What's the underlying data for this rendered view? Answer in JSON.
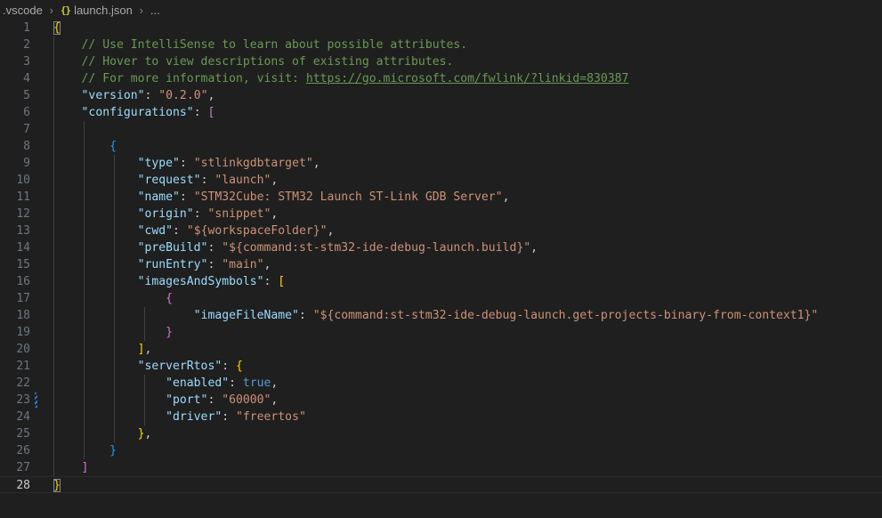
{
  "breadcrumb": {
    "folder": ".vscode",
    "file_icon": "{}",
    "file": "launch.json",
    "more": "..."
  },
  "editor": {
    "current_line": 28,
    "lines": [
      {
        "n": "1",
        "tokens": [
          {
            "t": "{",
            "c": "b1 bm"
          }
        ]
      },
      {
        "n": "2",
        "tokens": [
          {
            "t": "    "
          },
          {
            "t": "// Use IntelliSense to learn about possible attributes.",
            "c": "c"
          }
        ]
      },
      {
        "n": "3",
        "tokens": [
          {
            "t": "    "
          },
          {
            "t": "// Hover to view descriptions of existing attributes.",
            "c": "c"
          }
        ]
      },
      {
        "n": "4",
        "tokens": [
          {
            "t": "    "
          },
          {
            "t": "// For more information, visit: ",
            "c": "c"
          },
          {
            "t": "https://go.microsoft.com/fwlink/?linkid=830387",
            "c": "u",
            "link": true
          }
        ]
      },
      {
        "n": "5",
        "tokens": [
          {
            "t": "    "
          },
          {
            "t": "\"version\"",
            "c": "k"
          },
          {
            "t": ": ",
            "c": "p"
          },
          {
            "t": "\"0.2.0\"",
            "c": "s"
          },
          {
            "t": ",",
            "c": "p"
          }
        ]
      },
      {
        "n": "6",
        "tokens": [
          {
            "t": "    "
          },
          {
            "t": "\"configurations\"",
            "c": "k"
          },
          {
            "t": ": ",
            "c": "p"
          },
          {
            "t": "[",
            "c": "b2"
          }
        ]
      },
      {
        "n": "7",
        "tokens": [
          {
            "t": ""
          }
        ]
      },
      {
        "n": "8",
        "tokens": [
          {
            "t": "        "
          },
          {
            "t": "{",
            "c": "b3"
          }
        ]
      },
      {
        "n": "9",
        "tokens": [
          {
            "t": "            "
          },
          {
            "t": "\"type\"",
            "c": "k"
          },
          {
            "t": ": ",
            "c": "p"
          },
          {
            "t": "\"stlinkgdbtarget\"",
            "c": "s"
          },
          {
            "t": ",",
            "c": "p"
          }
        ]
      },
      {
        "n": "10",
        "tokens": [
          {
            "t": "            "
          },
          {
            "t": "\"request\"",
            "c": "k"
          },
          {
            "t": ": ",
            "c": "p"
          },
          {
            "t": "\"launch\"",
            "c": "s"
          },
          {
            "t": ",",
            "c": "p"
          }
        ]
      },
      {
        "n": "11",
        "tokens": [
          {
            "t": "            "
          },
          {
            "t": "\"name\"",
            "c": "k"
          },
          {
            "t": ": ",
            "c": "p"
          },
          {
            "t": "\"STM32Cube: STM32 Launch ST-Link GDB Server\"",
            "c": "s"
          },
          {
            "t": ",",
            "c": "p"
          }
        ]
      },
      {
        "n": "12",
        "tokens": [
          {
            "t": "            "
          },
          {
            "t": "\"origin\"",
            "c": "k"
          },
          {
            "t": ": ",
            "c": "p"
          },
          {
            "t": "\"snippet\"",
            "c": "s"
          },
          {
            "t": ",",
            "c": "p"
          }
        ]
      },
      {
        "n": "13",
        "tokens": [
          {
            "t": "            "
          },
          {
            "t": "\"cwd\"",
            "c": "k"
          },
          {
            "t": ": ",
            "c": "p"
          },
          {
            "t": "\"${workspaceFolder}\"",
            "c": "s"
          },
          {
            "t": ",",
            "c": "p"
          }
        ]
      },
      {
        "n": "14",
        "tokens": [
          {
            "t": "            "
          },
          {
            "t": "\"preBuild\"",
            "c": "k"
          },
          {
            "t": ": ",
            "c": "p"
          },
          {
            "t": "\"${command:st-stm32-ide-debug-launch.build}\"",
            "c": "s"
          },
          {
            "t": ",",
            "c": "p"
          }
        ]
      },
      {
        "n": "15",
        "tokens": [
          {
            "t": "            "
          },
          {
            "t": "\"runEntry\"",
            "c": "k"
          },
          {
            "t": ": ",
            "c": "p"
          },
          {
            "t": "\"main\"",
            "c": "s"
          },
          {
            "t": ",",
            "c": "p"
          }
        ]
      },
      {
        "n": "16",
        "tokens": [
          {
            "t": "            "
          },
          {
            "t": "\"imagesAndSymbols\"",
            "c": "k"
          },
          {
            "t": ": ",
            "c": "p"
          },
          {
            "t": "[",
            "c": "b1"
          }
        ]
      },
      {
        "n": "17",
        "tokens": [
          {
            "t": "                "
          },
          {
            "t": "{",
            "c": "b2"
          }
        ]
      },
      {
        "n": "18",
        "tokens": [
          {
            "t": "                    "
          },
          {
            "t": "\"imageFileName\"",
            "c": "k"
          },
          {
            "t": ": ",
            "c": "p"
          },
          {
            "t": "\"${command:st-stm32-ide-debug-launch.get-projects-binary-from-context1}\"",
            "c": "s"
          }
        ]
      },
      {
        "n": "19",
        "tokens": [
          {
            "t": "                "
          },
          {
            "t": "}",
            "c": "b2"
          }
        ]
      },
      {
        "n": "20",
        "tokens": [
          {
            "t": "            "
          },
          {
            "t": "]",
            "c": "b1"
          },
          {
            "t": ",",
            "c": "p"
          }
        ]
      },
      {
        "n": "21",
        "tokens": [
          {
            "t": "            "
          },
          {
            "t": "\"serverRtos\"",
            "c": "k"
          },
          {
            "t": ": ",
            "c": "p"
          },
          {
            "t": "{",
            "c": "b1"
          }
        ]
      },
      {
        "n": "22",
        "tokens": [
          {
            "t": "                "
          },
          {
            "t": "\"enabled\"",
            "c": "k"
          },
          {
            "t": ": ",
            "c": "p"
          },
          {
            "t": "true",
            "c": "b"
          },
          {
            "t": ",",
            "c": "p"
          }
        ]
      },
      {
        "n": "23",
        "tokens": [
          {
            "t": "                "
          },
          {
            "t": "\"port\"",
            "c": "k"
          },
          {
            "t": ": ",
            "c": "p"
          },
          {
            "t": "\"60000\"",
            "c": "s"
          },
          {
            "t": ",",
            "c": "p"
          }
        ]
      },
      {
        "n": "24",
        "tokens": [
          {
            "t": "                "
          },
          {
            "t": "\"driver\"",
            "c": "k"
          },
          {
            "t": ": ",
            "c": "p"
          },
          {
            "t": "\"freertos\"",
            "c": "s"
          }
        ]
      },
      {
        "n": "25",
        "tokens": [
          {
            "t": "            "
          },
          {
            "t": "}",
            "c": "b1"
          },
          {
            "t": ",",
            "c": "p"
          }
        ]
      },
      {
        "n": "26",
        "tokens": [
          {
            "t": "        "
          },
          {
            "t": "}",
            "c": "b3"
          }
        ]
      },
      {
        "n": "27",
        "tokens": [
          {
            "t": "    "
          },
          {
            "t": "]",
            "c": "b2"
          }
        ]
      },
      {
        "n": "28",
        "tokens": [
          {
            "t": "}",
            "c": "b1 bm"
          }
        ]
      }
    ]
  },
  "colors": {
    "background": "#1f1f1f",
    "comment": "#6a9955",
    "property": "#9cdcfe",
    "string": "#ce9178",
    "keyword": "#569cd6",
    "bracket_gold": "#ffd700",
    "bracket_orchid": "#da70d6",
    "bracket_blue": "#179fff",
    "modified_gutter": "#2f7ad9"
  }
}
